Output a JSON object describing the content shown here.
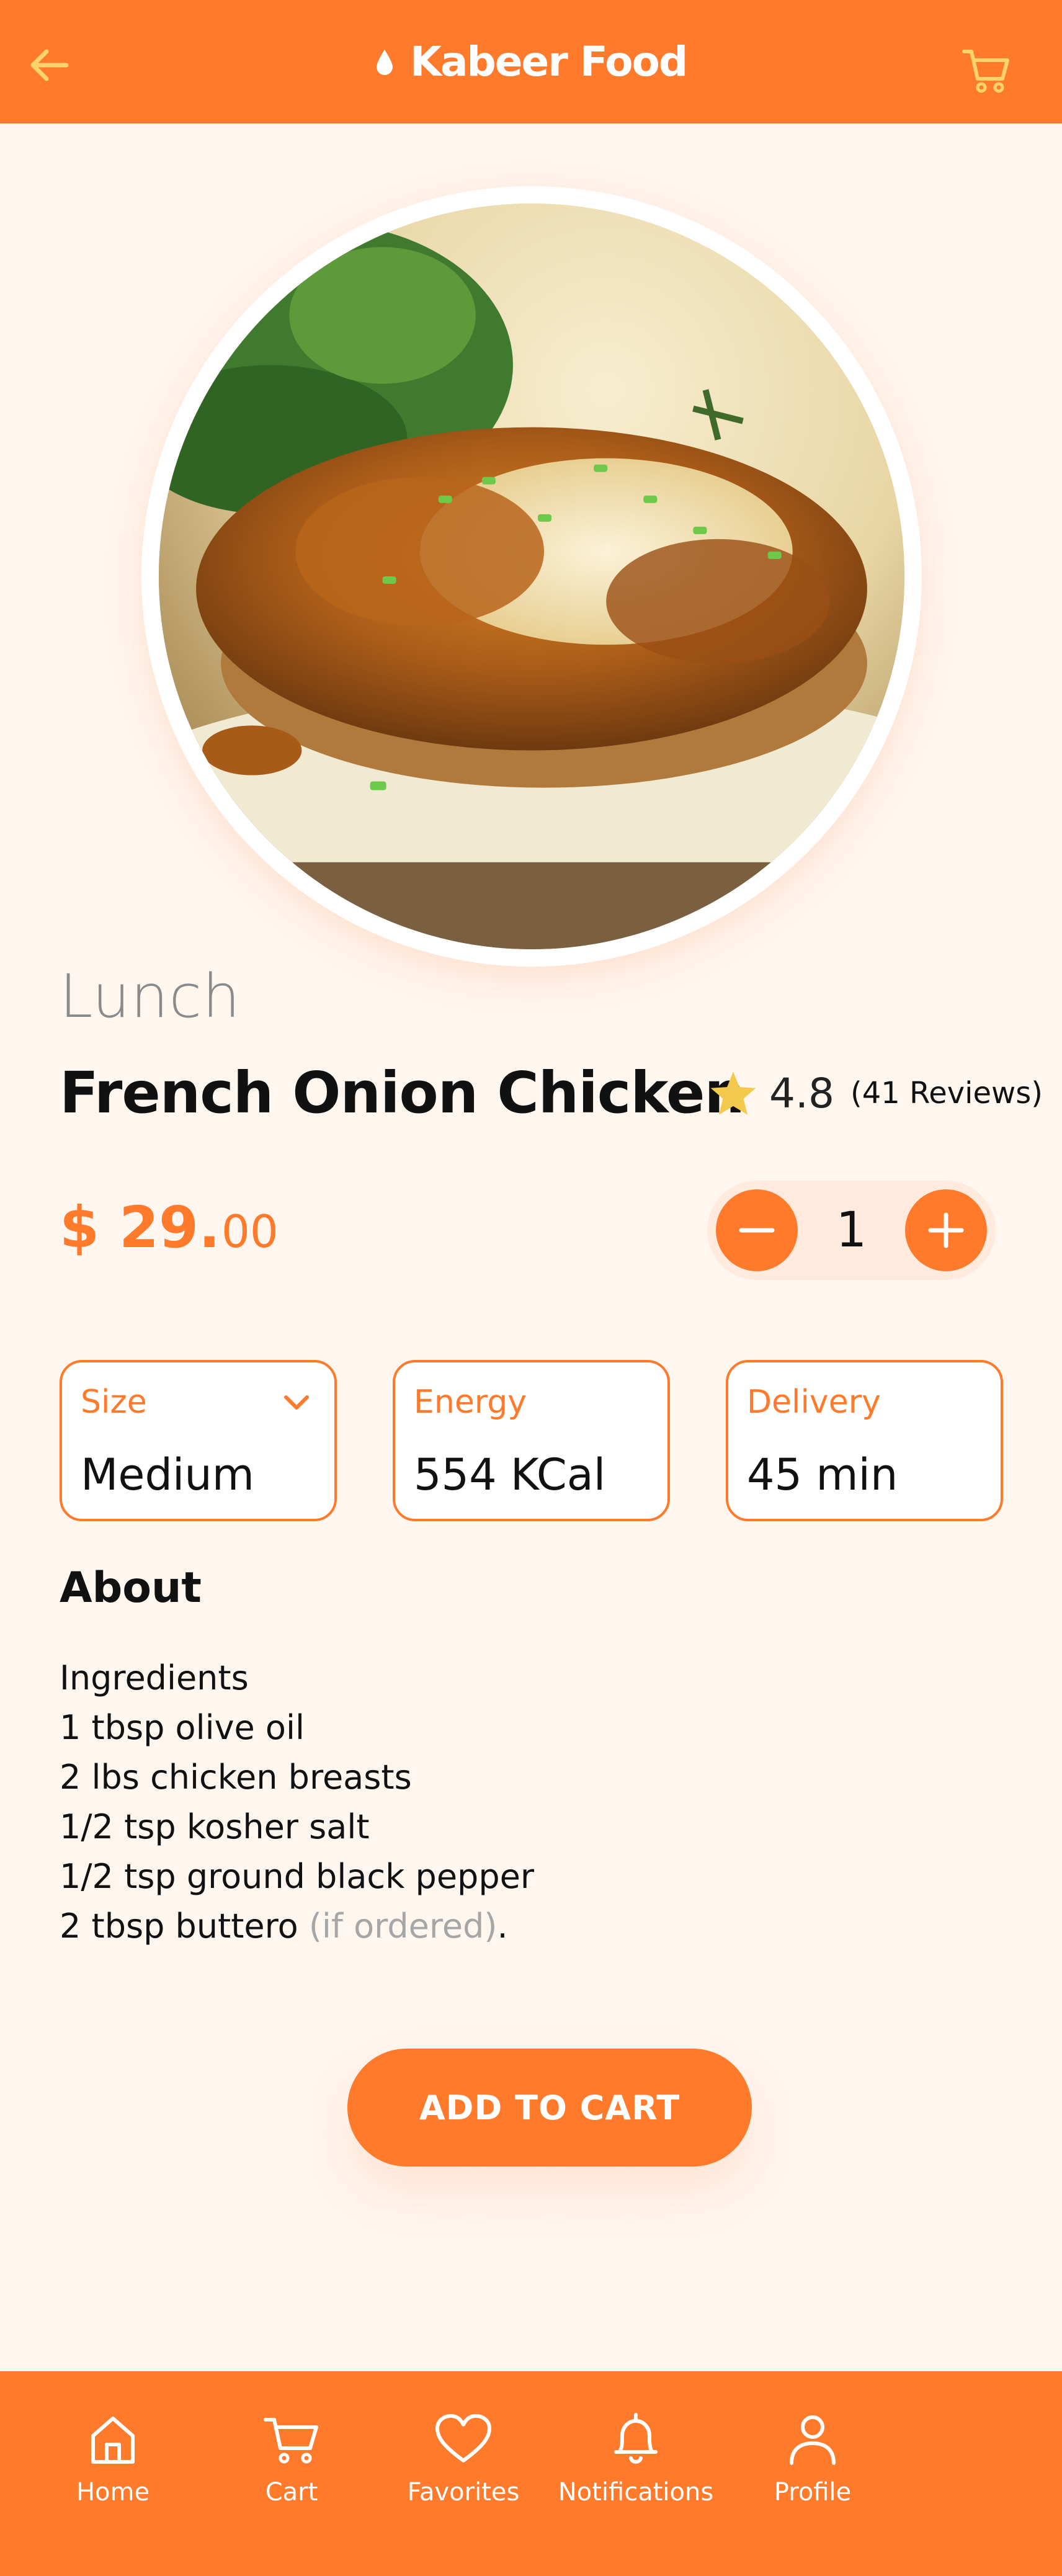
{
  "header": {
    "title": "Kabeer Food",
    "icons": {
      "back": "arrow-left-icon",
      "cart": "shopping-cart-icon",
      "logo": "drop-icon"
    },
    "colors": {
      "bar": "#ff7a2b",
      "icon": "#ffd36b",
      "text": "#ffffff"
    }
  },
  "product": {
    "category": "Lunch",
    "name": "French Onion Chicken",
    "rating": {
      "score": "4.8",
      "reviews": "(41 Reviews)"
    },
    "price": {
      "currency_main": "$ 29.",
      "cents": "00"
    },
    "quantity": "1"
  },
  "specs": [
    {
      "label": "Size",
      "value": "Medium"
    },
    {
      "label": "Energy",
      "value": "554 KCal"
    },
    {
      "label": "Delivery",
      "value": "45 min"
    }
  ],
  "about": {
    "title": "About",
    "lines": [
      "Ingredients",
      "1 tbsp olive oil",
      "2 lbs chicken breasts",
      "1/2 tsp kosher salt",
      "1/2 tsp ground black pepper"
    ],
    "last_line": {
      "text": "2 tbsp buttero ",
      "muted": "(if ordered)",
      "end": "."
    }
  },
  "cta": {
    "add_to_cart": "ADD TO CART"
  },
  "bottom_nav": [
    {
      "label": "Home",
      "icon": "home-icon"
    },
    {
      "label": "Cart",
      "icon": "cart-icon"
    },
    {
      "label": "Favorites",
      "icon": "heart-icon"
    },
    {
      "label": "Notifications",
      "icon": "bell-icon"
    },
    {
      "label": "Profile",
      "icon": "user-icon"
    }
  ],
  "accent": "#ff7a2b",
  "star_color": "#f2c94c"
}
